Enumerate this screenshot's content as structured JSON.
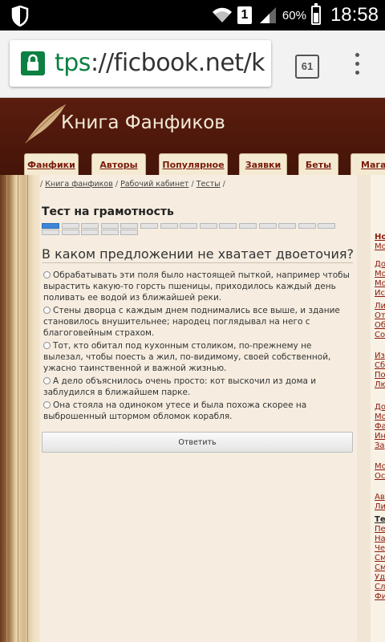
{
  "status_bar": {
    "sim_label": "1",
    "battery_percent": "60%",
    "battery_level": 0.6,
    "time": "18:58",
    "icons": [
      "shield-icon",
      "wifi-icon",
      "signal-icon",
      "battery-icon"
    ]
  },
  "browser": {
    "url_scheme": "tps",
    "url_rest": "://ficbook.net/k",
    "tab_count": "61"
  },
  "site": {
    "title": "Книга Фанфиков",
    "nav": [
      "Фанфики",
      "Авторы",
      "Популярное",
      "Заявки",
      "Беты",
      "Магаз"
    ]
  },
  "breadcrumb": {
    "items": [
      "Книга фанфиков",
      "Рабочий кабинет",
      "Тесты"
    ],
    "separator": "/"
  },
  "test": {
    "title": "Тест на грамотность",
    "progress": {
      "current": 1,
      "total": 20
    },
    "question": "В каком предложении не хватает двоеточия?",
    "answers": [
      "Обрабатывать эти поля было настоящей пыткой, например чтобы вырастить какую-то горсть пшеницы, приходилось каждый день поливать ее водой из ближайшей реки.",
      "Стены дворца с каждым днем поднимались все выше, и здание становилось внушительнее; народец поглядывал на него с благоговейным страхом.",
      "Тот, кто обитал под кухонным столиком, по-прежнему не вылезал, чтобы поесть а жил, по-видимому, своей собственной, ужасно таинственной и важной жизнью.",
      "А дело объяснилось очень просто: кот выскочил из дома и заблудился в ближайшем парке.",
      "Она стояла на одиноком утесе и была похожа скорее на выброшенный штормом обломок корабля."
    ],
    "submit_label": "Ответить"
  },
  "right_column_fragments": [
    "Но",
    "Мо",
    "До",
    "Мо",
    "Мо",
    "Ис",
    "Ли",
    "От",
    "Об",
    "Со",
    "Из",
    "Сб",
    "По",
    "Лю",
    "До",
    "Мо",
    "Фа",
    "Ин",
    "За",
    "Мо",
    "Ос",
    "Ав",
    "Ли",
    "Те",
    "Пе",
    "На",
    "Че",
    "См",
    "См",
    "Уд",
    "Сл",
    "Фи"
  ],
  "colors": {
    "header_bg": "#4c1a0d",
    "nav_tab_bg": "#f4ead2",
    "link": "#7a1a0a",
    "progress_done": "#3d86d8",
    "url_scheme": "#0b8043"
  }
}
